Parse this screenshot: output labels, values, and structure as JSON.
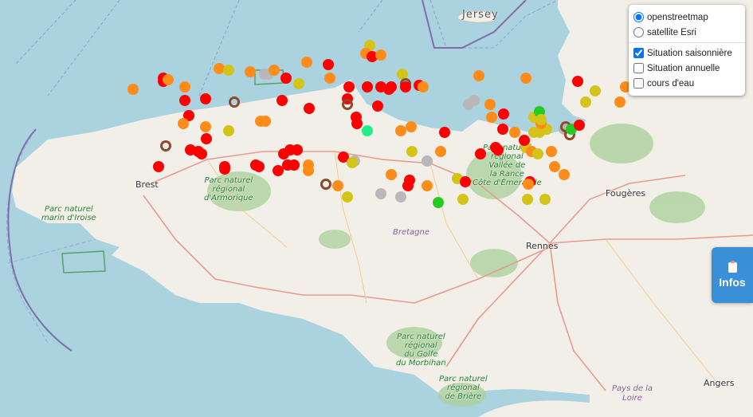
{
  "map": {
    "places": [
      {
        "id": "jersey",
        "label": "Jersey",
        "kind": "island"
      },
      {
        "id": "brest",
        "label": "Brest",
        "kind": "city"
      },
      {
        "id": "rennes",
        "label": "Rennes",
        "kind": "city"
      },
      {
        "id": "fougeres",
        "label": "Fougères",
        "kind": "city"
      },
      {
        "id": "angers",
        "label": "Angers",
        "kind": "city"
      },
      {
        "id": "bretagne",
        "label": "Bretagne",
        "kind": "region"
      },
      {
        "id": "pays-loire",
        "label": "Pays de la\nLoire",
        "kind": "region"
      }
    ],
    "parks": [
      {
        "id": "iroise",
        "label": "Parc naturel\nmarin d'Iroise"
      },
      {
        "id": "armorique",
        "label": "Parc naturel\nrégional\nd'Armorique"
      },
      {
        "id": "rance",
        "label": "Parc naturel\nrégional\nVallée de\nla Rance\nCôte d'Émeraude"
      },
      {
        "id": "morbihan",
        "label": "Parc naturel\nrégional\ndu Golfe\ndu Morbihan"
      },
      {
        "id": "briere",
        "label": "Parc naturel\nrégional\nde Brière"
      }
    ]
  },
  "layers": {
    "base": [
      {
        "label": "openstreetmap",
        "checked": true
      },
      {
        "label": "satellite Esri",
        "checked": false
      }
    ],
    "overlays": [
      {
        "label": "Situation saisonnière",
        "checked": true
      },
      {
        "label": "Situation annuelle",
        "checked": false
      },
      {
        "label": "cours d'eau",
        "checked": false
      }
    ]
  },
  "info_button": {
    "label": "Infos"
  },
  "colors": {
    "red": "#ff0000",
    "orange": "#ff8c1a",
    "yellow": "#d4c41a",
    "grey": "#b8b8b8",
    "green": "#22cc22",
    "teal": "#22ee88",
    "ring": "#8b4a2b"
  },
  "markers": [
    {
      "lat": 49.06,
      "lon": -3.1,
      "status": "yellow"
    },
    {
      "lat": 49.02,
      "lon": -3.13,
      "status": "orange"
    },
    {
      "lat": 49.0,
      "lon": -3.08,
      "status": "red"
    },
    {
      "lat": 49.01,
      "lon": -3.02,
      "status": "orange"
    },
    {
      "lat": 48.97,
      "lon": -3.56,
      "status": "orange"
    },
    {
      "lat": 48.96,
      "lon": -3.4,
      "status": "red"
    },
    {
      "lat": 48.94,
      "lon": -4.2,
      "status": "orange"
    },
    {
      "lat": 48.93,
      "lon": -4.13,
      "status": "yellow"
    },
    {
      "lat": 48.92,
      "lon": -3.97,
      "status": "orange"
    },
    {
      "lat": 48.91,
      "lon": -3.87,
      "status": "grey"
    },
    {
      "lat": 48.91,
      "lon": -3.84,
      "status": "grey"
    },
    {
      "lat": 48.93,
      "lon": -3.8,
      "status": "orange"
    },
    {
      "lat": 48.89,
      "lon": -3.71,
      "status": "red"
    },
    {
      "lat": 48.89,
      "lon": -3.39,
      "status": "orange"
    },
    {
      "lat": 48.86,
      "lon": -3.62,
      "status": "yellow"
    },
    {
      "lat": 48.91,
      "lon": -2.86,
      "status": "yellow"
    },
    {
      "lat": 48.86,
      "lon": -2.84,
      "status": "ring"
    },
    {
      "lat": 48.9,
      "lon": -2.3,
      "status": "orange"
    },
    {
      "lat": 48.89,
      "lon": -4.61,
      "status": "red"
    },
    {
      "lat": 48.87,
      "lon": -4.61,
      "status": "red"
    },
    {
      "lat": 48.88,
      "lon": -4.57,
      "status": "orange"
    },
    {
      "lat": 48.83,
      "lon": -4.83,
      "status": "orange"
    },
    {
      "lat": 48.84,
      "lon": -4.45,
      "status": "orange"
    },
    {
      "lat": 48.78,
      "lon": -4.3,
      "status": "red"
    },
    {
      "lat": 48.77,
      "lon": -4.45,
      "status": "red"
    },
    {
      "lat": 48.76,
      "lon": -4.09,
      "status": "ring"
    },
    {
      "lat": 48.77,
      "lon": -3.74,
      "status": "red"
    },
    {
      "lat": 48.84,
      "lon": -3.25,
      "status": "red"
    },
    {
      "lat": 48.84,
      "lon": -3.12,
      "status": "red"
    },
    {
      "lat": 48.84,
      "lon": -3.02,
      "status": "red"
    },
    {
      "lat": 48.83,
      "lon": -2.96,
      "status": "red"
    },
    {
      "lat": 48.84,
      "lon": -2.94,
      "status": "red"
    },
    {
      "lat": 48.84,
      "lon": -2.84,
      "status": "red"
    },
    {
      "lat": 48.85,
      "lon": -2.74,
      "status": "red"
    },
    {
      "lat": 48.84,
      "lon": -2.71,
      "status": "orange"
    },
    {
      "lat": 48.78,
      "lon": -3.26,
      "status": "red"
    },
    {
      "lat": 48.75,
      "lon": -3.26,
      "status": "ring"
    },
    {
      "lat": 48.73,
      "lon": -3.54,
      "status": "red"
    },
    {
      "lat": 48.74,
      "lon": -3.04,
      "status": "red"
    },
    {
      "lat": 48.75,
      "lon": -2.38,
      "status": "grey"
    },
    {
      "lat": 48.77,
      "lon": -2.34,
      "status": "grey"
    },
    {
      "lat": 48.75,
      "lon": -2.22,
      "status": "orange"
    },
    {
      "lat": 48.89,
      "lon": -1.96,
      "status": "orange"
    },
    {
      "lat": 48.87,
      "lon": -1.58,
      "status": "red"
    },
    {
      "lat": 48.82,
      "lon": -1.45,
      "status": "yellow"
    },
    {
      "lat": 48.76,
      "lon": -1.52,
      "status": "yellow"
    },
    {
      "lat": 48.84,
      "lon": -1.23,
      "status": "orange"
    },
    {
      "lat": 48.76,
      "lon": -1.27,
      "status": "orange"
    },
    {
      "lat": 48.69,
      "lon": -4.42,
      "status": "red"
    },
    {
      "lat": 48.65,
      "lon": -4.46,
      "status": "orange"
    },
    {
      "lat": 48.63,
      "lon": -4.3,
      "status": "orange"
    },
    {
      "lat": 48.61,
      "lon": -4.13,
      "status": "yellow"
    },
    {
      "lat": 48.66,
      "lon": -3.9,
      "status": "orange"
    },
    {
      "lat": 48.66,
      "lon": -3.86,
      "status": "orange"
    },
    {
      "lat": 48.68,
      "lon": -3.2,
      "status": "red"
    },
    {
      "lat": 48.65,
      "lon": -3.19,
      "status": "red"
    },
    {
      "lat": 48.61,
      "lon": -3.12,
      "status": "teal"
    },
    {
      "lat": 48.63,
      "lon": -2.8,
      "status": "orange"
    },
    {
      "lat": 48.61,
      "lon": -2.87,
      "status": "orange"
    },
    {
      "lat": 48.6,
      "lon": -2.55,
      "status": "red"
    },
    {
      "lat": 48.68,
      "lon": -2.21,
      "status": "orange"
    },
    {
      "lat": 48.7,
      "lon": -2.12,
      "status": "red"
    },
    {
      "lat": 48.62,
      "lon": -2.13,
      "status": "red"
    },
    {
      "lat": 48.6,
      "lon": -2.04,
      "status": "orange"
    },
    {
      "lat": 48.57,
      "lon": -4.29,
      "status": "red"
    },
    {
      "lat": 48.53,
      "lon": -4.59,
      "status": "ring"
    },
    {
      "lat": 48.51,
      "lon": -4.41,
      "status": "red"
    },
    {
      "lat": 48.5,
      "lon": -4.35,
      "status": "red"
    },
    {
      "lat": 48.49,
      "lon": -4.33,
      "status": "red"
    },
    {
      "lat": 48.51,
      "lon": -3.68,
      "status": "red"
    },
    {
      "lat": 48.51,
      "lon": -3.63,
      "status": "red"
    },
    {
      "lat": 48.49,
      "lon": -3.73,
      "status": "red"
    },
    {
      "lat": 48.5,
      "lon": -2.79,
      "status": "yellow"
    },
    {
      "lat": 48.5,
      "lon": -2.58,
      "status": "orange"
    },
    {
      "lat": 48.49,
      "lon": -2.29,
      "status": "red"
    },
    {
      "lat": 48.52,
      "lon": -2.18,
      "status": "red"
    },
    {
      "lat": 48.51,
      "lon": -2.16,
      "status": "red"
    },
    {
      "lat": 48.47,
      "lon": -3.29,
      "status": "red"
    },
    {
      "lat": 48.45,
      "lon": -3.21,
      "status": "grey"
    },
    {
      "lat": 48.44,
      "lon": -3.23,
      "status": "yellow"
    },
    {
      "lat": 48.45,
      "lon": -2.68,
      "status": "grey"
    },
    {
      "lat": 48.42,
      "lon": -4.64,
      "status": "red"
    },
    {
      "lat": 48.42,
      "lon": -4.16,
      "status": "red"
    },
    {
      "lat": 48.42,
      "lon": -3.91,
      "status": "red"
    },
    {
      "lat": 48.43,
      "lon": -3.93,
      "status": "red"
    },
    {
      "lat": 48.41,
      "lon": -4.16,
      "status": "red"
    },
    {
      "lat": 48.4,
      "lon": -3.77,
      "status": "red"
    },
    {
      "lat": 48.4,
      "lon": -3.55,
      "status": "orange"
    },
    {
      "lat": 48.43,
      "lon": -3.55,
      "status": "orange"
    },
    {
      "lat": 48.43,
      "lon": -3.65,
      "status": "red"
    },
    {
      "lat": 48.43,
      "lon": -3.7,
      "status": "red"
    },
    {
      "lat": 48.38,
      "lon": -2.94,
      "status": "orange"
    },
    {
      "lat": 48.33,
      "lon": -3.42,
      "status": "ring"
    },
    {
      "lat": 48.35,
      "lon": -2.81,
      "status": "red"
    },
    {
      "lat": 48.32,
      "lon": -2.82,
      "status": "red"
    },
    {
      "lat": 48.32,
      "lon": -3.33,
      "status": "orange"
    },
    {
      "lat": 48.32,
      "lon": -2.68,
      "status": "orange"
    },
    {
      "lat": 48.36,
      "lon": -2.46,
      "status": "yellow"
    },
    {
      "lat": 48.34,
      "lon": -2.4,
      "status": "red"
    },
    {
      "lat": 48.28,
      "lon": -3.02,
      "status": "grey"
    },
    {
      "lat": 48.26,
      "lon": -2.87,
      "status": "grey"
    },
    {
      "lat": 48.26,
      "lon": -3.26,
      "status": "yellow"
    },
    {
      "lat": 48.23,
      "lon": -2.6,
      "status": "green"
    },
    {
      "lat": 48.25,
      "lon": -2.42,
      "status": "yellow"
    },
    {
      "lat": 48.34,
      "lon": -1.93,
      "status": "red"
    },
    {
      "lat": 48.33,
      "lon": -1.94,
      "status": "orange"
    },
    {
      "lat": 48.25,
      "lon": -1.95,
      "status": "yellow"
    },
    {
      "lat": 48.25,
      "lon": -1.82,
      "status": "yellow"
    },
    {
      "lat": 48.42,
      "lon": -1.75,
      "status": "orange"
    },
    {
      "lat": 48.38,
      "lon": -1.68,
      "status": "orange"
    },
    {
      "lat": 48.52,
      "lon": -1.96,
      "status": "yellow"
    },
    {
      "lat": 48.5,
      "lon": -1.92,
      "status": "orange"
    },
    {
      "lat": 48.49,
      "lon": -1.87,
      "status": "yellow"
    },
    {
      "lat": 48.5,
      "lon": -1.77,
      "status": "orange"
    },
    {
      "lat": 48.56,
      "lon": -1.97,
      "status": "red"
    },
    {
      "lat": 48.6,
      "lon": -1.9,
      "status": "yellow"
    },
    {
      "lat": 48.6,
      "lon": -1.86,
      "status": "yellow"
    },
    {
      "lat": 48.62,
      "lon": -1.81,
      "status": "yellow"
    },
    {
      "lat": 48.62,
      "lon": -1.68,
      "status": "grey"
    },
    {
      "lat": 48.63,
      "lon": -1.67,
      "status": "ring"
    },
    {
      "lat": 48.59,
      "lon": -1.64,
      "status": "ring"
    },
    {
      "lat": 48.62,
      "lon": -1.63,
      "status": "green"
    },
    {
      "lat": 48.64,
      "lon": -1.57,
      "status": "red"
    },
    {
      "lat": 48.68,
      "lon": -1.9,
      "status": "yellow"
    },
    {
      "lat": 48.65,
      "lon": -1.85,
      "status": "orange"
    },
    {
      "lat": 48.71,
      "lon": -1.86,
      "status": "green"
    },
    {
      "lat": 48.67,
      "lon": -1.85,
      "status": "yellow"
    }
  ]
}
